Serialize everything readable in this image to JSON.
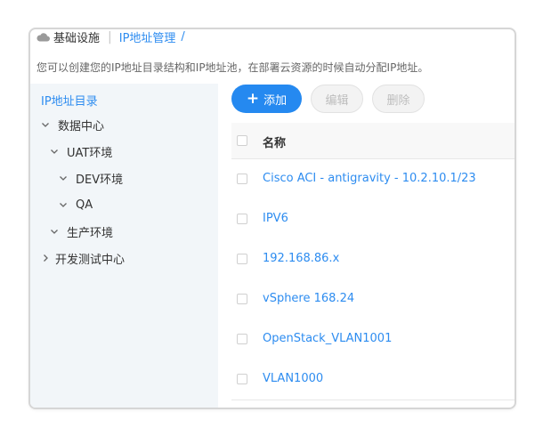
{
  "breadcrumb": {
    "root": "基础设施",
    "separator": "|",
    "current": "IP地址管理",
    "slash": "/"
  },
  "description": "您可以创建您的IP地址目录结构和IP地址池，在部署云资源的时候自动分配IP地址。",
  "tree": {
    "title": "IP地址目录",
    "nodes": [
      {
        "label": "数据中心",
        "expanded": true
      },
      {
        "label": "UAT环境",
        "expanded": true
      },
      {
        "label": "DEV环境",
        "expanded": true
      },
      {
        "label": "QA",
        "expanded": true
      },
      {
        "label": "生产环境",
        "expanded": true
      },
      {
        "label": "开发测试中心",
        "expanded": false
      }
    ]
  },
  "toolbar": {
    "add_icon": "+",
    "add_label": "添加",
    "edit_label": "编辑",
    "delete_label": "删除"
  },
  "table": {
    "header": "名称",
    "rows": [
      "Cisco ACI - antigravity - 10.2.10.1/23",
      "IPV6",
      "192.168.86.x",
      "vSphere 168.24",
      "OpenStack_VLAN1001",
      "VLAN1000"
    ]
  },
  "colors": {
    "accent": "#2d8cf0",
    "primary_button": "#2589f0",
    "tree_background": "#f2f6f9"
  },
  "icons": {
    "breadcrumb": "cloud-icon",
    "expanded": "chevron-down-icon",
    "collapsed": "chevron-right-icon",
    "add": "plus-icon"
  }
}
